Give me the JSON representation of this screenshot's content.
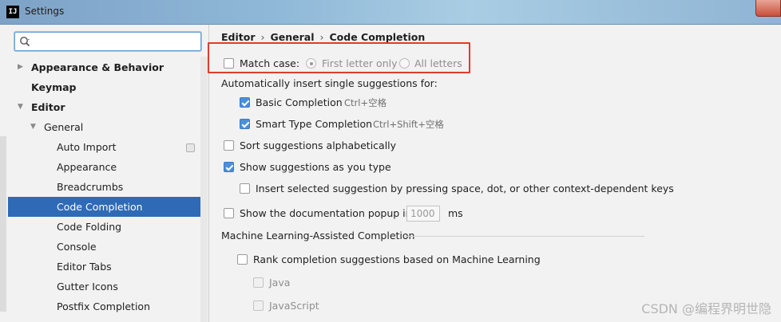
{
  "window": {
    "icon_text": "IJ",
    "title": "Settings"
  },
  "search": {
    "placeholder": "",
    "value": ""
  },
  "tree": {
    "appearance_behavior": "Appearance & Behavior",
    "keymap": "Keymap",
    "editor": "Editor",
    "general": "General",
    "auto_import": "Auto Import",
    "appearance": "Appearance",
    "breadcrumbs": "Breadcrumbs",
    "code_completion": "Code Completion",
    "code_folding": "Code Folding",
    "console": "Console",
    "editor_tabs": "Editor Tabs",
    "gutter_icons": "Gutter Icons",
    "postfix_completion": "Postfix Completion"
  },
  "breadcrumb": {
    "part1": "Editor",
    "part2": "General",
    "part3": "Code Completion",
    "separator": "›"
  },
  "settings": {
    "match_case": {
      "label": "Match case:",
      "checked": false
    },
    "first_letter_only": "First letter only",
    "all_letters": "All letters",
    "auto_insert_header": "Automatically insert single suggestions for:",
    "basic_completion": {
      "label": "Basic Completion",
      "shortcut": "Ctrl+空格",
      "checked": true
    },
    "smart_type_completion": {
      "label": "Smart Type Completion",
      "shortcut": "Ctrl+Shift+空格",
      "checked": true
    },
    "sort_alphabetically": {
      "label": "Sort suggestions alphabetically",
      "checked": false
    },
    "show_as_you_type": {
      "label": "Show suggestions as you type",
      "checked": true
    },
    "insert_selected": {
      "label": "Insert selected suggestion by pressing space, dot, or other context-dependent keys",
      "checked": false
    },
    "show_doc_popup": {
      "label": "Show the documentation popup in",
      "value": "1000",
      "unit": "ms",
      "checked": false
    },
    "ml_section_title": "Machine Learning-Assisted Completion",
    "rank_ml": {
      "label": "Rank completion suggestions based on Machine Learning",
      "checked": false
    },
    "java": "Java",
    "javascript": "JavaScript"
  },
  "watermark": "CSDN @编程界明世隐",
  "colors": {
    "selection": "#2e6ab5",
    "checkbox_checked": "#4a90d9",
    "highlight": "#e5392c"
  }
}
